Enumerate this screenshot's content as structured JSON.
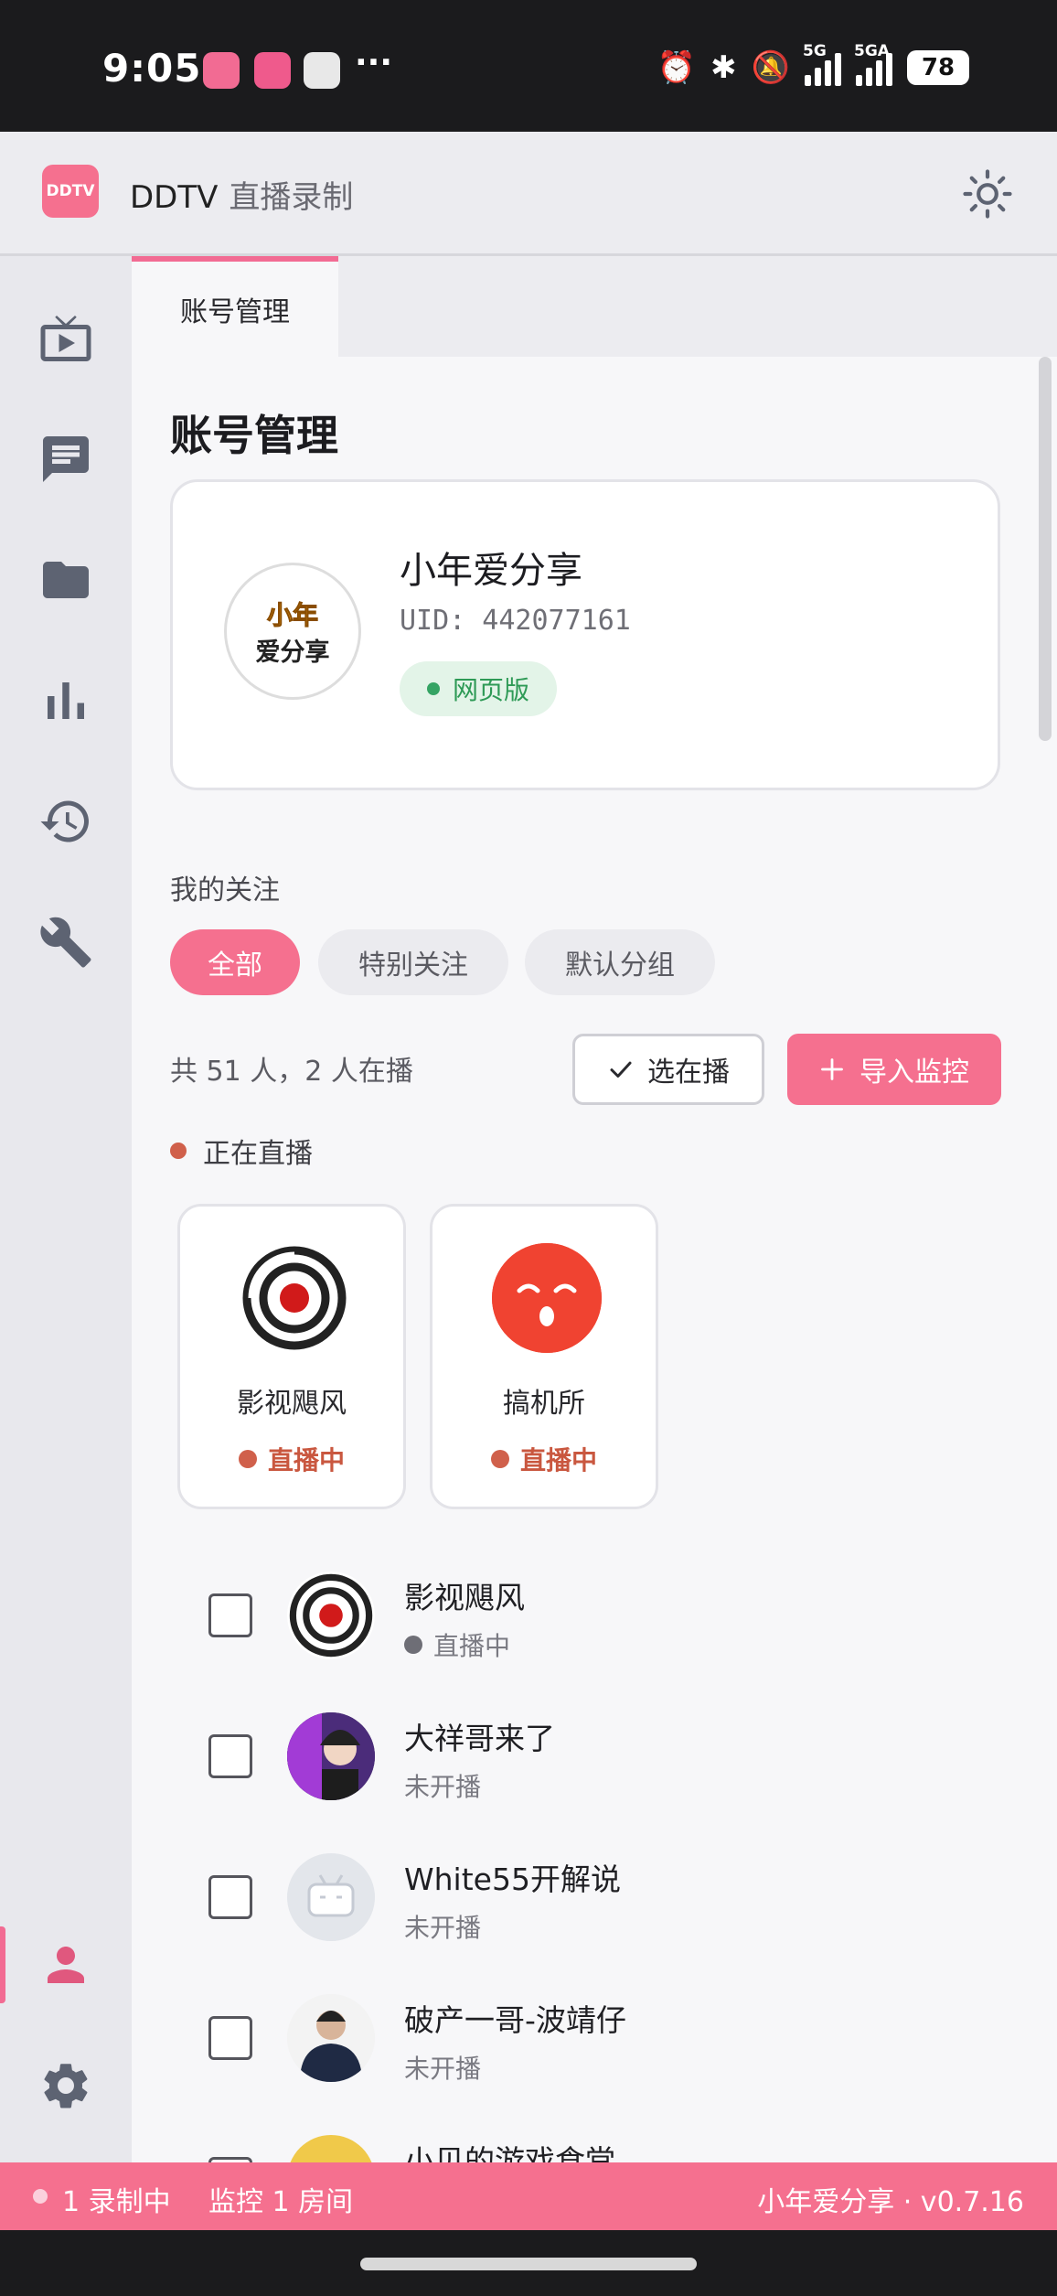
{
  "status_bar": {
    "time": "9:05",
    "more": "···",
    "net1": "5G",
    "net2": "5GA",
    "battery": "78"
  },
  "app": {
    "logo_text": "DDTV",
    "title": "DDTV",
    "subtitle": "直播录制"
  },
  "tab": {
    "label": "账号管理"
  },
  "page": {
    "title": "账号管理"
  },
  "account": {
    "avatar_line1": "小年",
    "avatar_line2": "爱分享",
    "name": "小年爱分享",
    "uid": "UID: 442077161",
    "badge": "网页版"
  },
  "follow": {
    "section_label": "我的关注",
    "chips": [
      "全部",
      "特别关注",
      "默认分组"
    ],
    "count_text": "共 51 人，2 人在播",
    "select_live_label": "选在播",
    "import_label": "导入监控",
    "live_header": "正在直播"
  },
  "live_cards": [
    {
      "name": "影视飓风",
      "status": "直播中"
    },
    {
      "name": "搞机所",
      "status": "直播中"
    }
  ],
  "list": [
    {
      "name": "影视飓风",
      "status": "直播中"
    },
    {
      "name": "大祥哥来了",
      "status": "未开播"
    },
    {
      "name": "White55开解说",
      "status": "未开播"
    },
    {
      "name": "破产一哥-波靖仔",
      "status": "未开播"
    },
    {
      "name": "小贝的游戏食堂",
      "status": ""
    }
  ],
  "footer": {
    "recording": "1 录制中",
    "monitoring": "监控 1 房间",
    "version": "小年爱分享 · v0.7.16"
  },
  "colors": {
    "accent": "#f5708f",
    "live": "#d0604b",
    "badge_green": "#2e9a56"
  }
}
